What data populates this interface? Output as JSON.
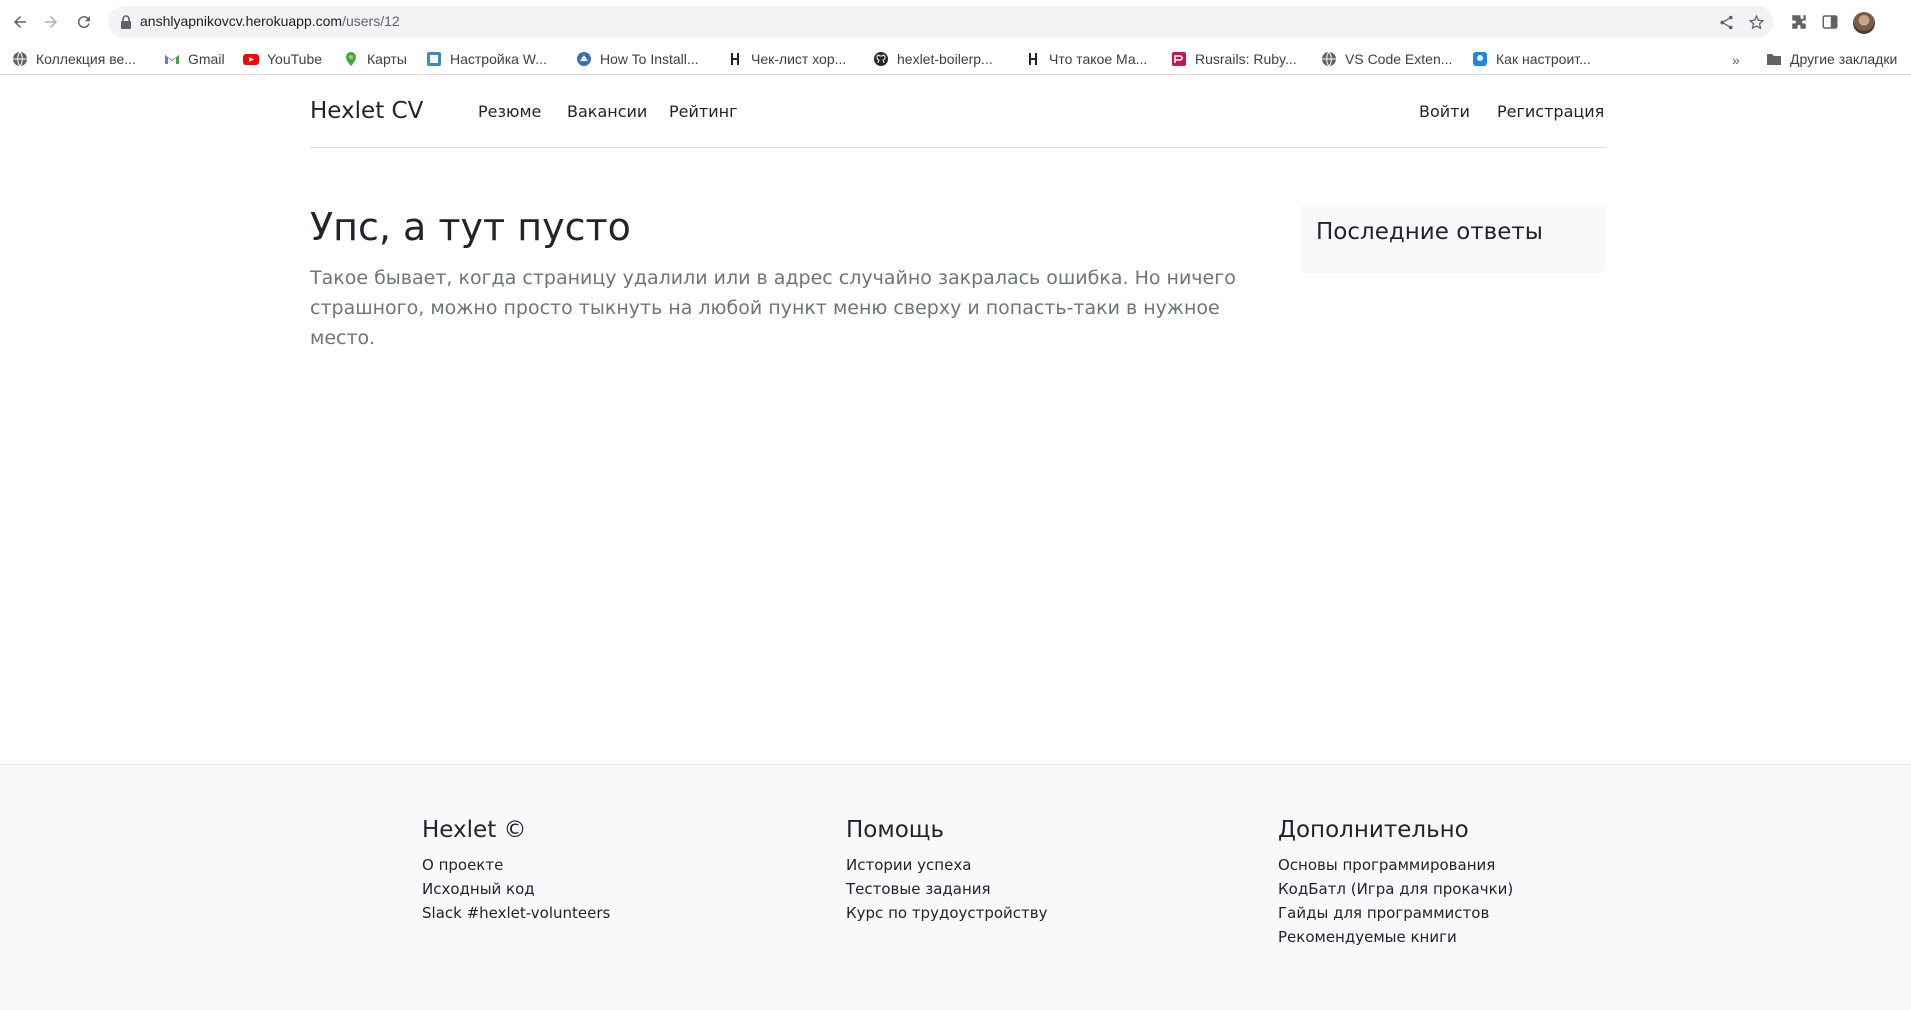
{
  "browser": {
    "url_host": "anshlyapnikovcv.herokuapp.com",
    "url_path": "/users/12",
    "bookmarks": [
      {
        "label": "Коллекция ве...",
        "icon": "globe-icon"
      },
      {
        "label": "Gmail",
        "icon": "gmail-icon"
      },
      {
        "label": "YouTube",
        "icon": "youtube-icon"
      },
      {
        "label": "Карты",
        "icon": "maps-icon"
      },
      {
        "label": "Настройка W...",
        "icon": "site-icon"
      },
      {
        "label": "How To Install...",
        "icon": "site-icon"
      },
      {
        "label": "Чек-лист хор...",
        "icon": "hexlet-icon"
      },
      {
        "label": "hexlet-boilerp...",
        "icon": "github-icon"
      },
      {
        "label": "Что такое Ма...",
        "icon": "hexlet-icon"
      },
      {
        "label": "Rusrails: Ruby...",
        "icon": "rails-icon"
      },
      {
        "label": "VS Code Exten...",
        "icon": "globe-icon"
      },
      {
        "label": "Как настроит...",
        "icon": "site-icon"
      }
    ],
    "more_bookmarks_label": "»",
    "other_bookmarks_label": "Другие закладки"
  },
  "header": {
    "brand": "Hexlet CV",
    "nav": [
      "Резюме",
      "Вакансии",
      "Рейтинг"
    ],
    "login": "Войти",
    "signup": "Регистрация"
  },
  "main": {
    "title": "Упс, а тут пусто",
    "text": "Такое бывает, когда страницу удалили или в адрес случайно закралась ошибка. Но ничего страшного, можно просто тыкнуть на любой пункт меню сверху и попасть-таки в нужное место."
  },
  "sidebar": {
    "title": "Последние ответы"
  },
  "footer": {
    "columns": [
      {
        "heading": "Hexlet ©",
        "links": [
          "О проекте",
          "Исходный код",
          "Slack #hexlet-volunteers"
        ]
      },
      {
        "heading": "Помощь",
        "links": [
          "Истории успеха",
          "Тестовые задания",
          "Курс по трудоустройству"
        ]
      },
      {
        "heading": "Дополнительно",
        "links": [
          "Основы программирования",
          "КодБатл (Игра для прокачки)",
          "Гайды для программистов",
          "Рекомендуемые книги"
        ]
      }
    ]
  }
}
